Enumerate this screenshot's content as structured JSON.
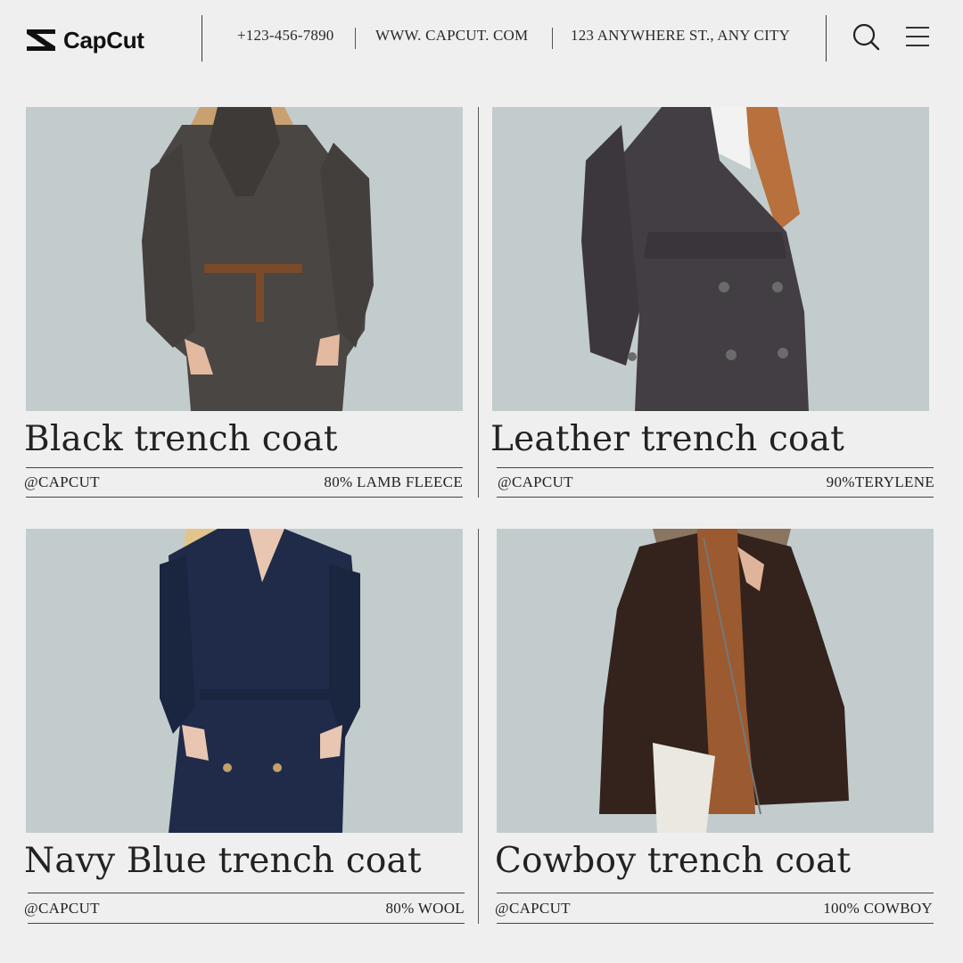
{
  "header": {
    "brand": "CapCut",
    "phone": "+123-456-7890",
    "website": "WWW. CAPCUT. COM",
    "address": "123 ANYWHERE ST., ANY CITY"
  },
  "icons": {
    "search": "search-icon",
    "menu": "menu-icon",
    "logo": "capcut-logo-icon"
  },
  "colors": {
    "background": "#efefef",
    "photo_bg": "#c3cccd"
  },
  "products": [
    {
      "title": "Black trench coat",
      "handle": "@CAPCUT",
      "material": "80% LAMB FLEECE"
    },
    {
      "title": "Leather trench coat",
      "handle": "@CAPCUT",
      "material": "90%TERYLENE"
    },
    {
      "title": "Navy Blue trench coat",
      "handle": "@CAPCUT",
      "material": "80% WOOL"
    },
    {
      "title": "Cowboy trench coat",
      "handle": "@CAPCUT",
      "material": "100% COWBOY"
    }
  ]
}
